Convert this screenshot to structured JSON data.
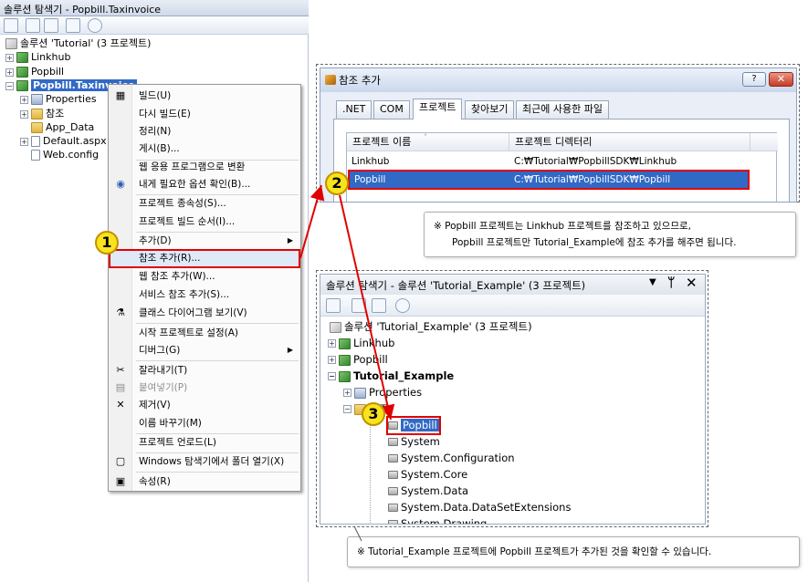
{
  "left_explorer": {
    "title": "솔루션 탐색기 - Popbill.Taxinvoice",
    "tree": {
      "solution": "솔루션 'Tutorial' (3 프로젝트)",
      "items": [
        "Linkhub",
        "Popbill",
        "Popbill.Taxinvoice"
      ],
      "children": [
        "Properties",
        "참조",
        "App_Data",
        "Default.aspx",
        "Web.config"
      ]
    }
  },
  "context_menu": {
    "items": [
      {
        "label": "빌드(U)",
        "icon": "build-icon"
      },
      {
        "label": "다시 빌드(E)",
        "icon": ""
      },
      {
        "label": "정리(N)",
        "icon": ""
      },
      {
        "label": "게시(B)...",
        "icon": ""
      },
      {
        "label": "웹 응용 프로그램으로 변환",
        "icon": ""
      },
      {
        "label": "내게 필요한 옵션 확인(B)...",
        "icon": "accessibility-icon"
      },
      {
        "label": "프로젝트 종속성(S)...",
        "icon": ""
      },
      {
        "label": "프로젝트 빌드 순서(I)...",
        "icon": ""
      },
      {
        "label": "추가(D)",
        "icon": "",
        "submenu": true
      },
      {
        "label": "참조 추가(R)...",
        "icon": "",
        "highlighted": true
      },
      {
        "label": "웹 참조 추가(W)...",
        "icon": ""
      },
      {
        "label": "서비스 참조 추가(S)...",
        "icon": ""
      },
      {
        "label": "클래스 다이어그램 보기(V)",
        "icon": "class-diagram-icon"
      },
      {
        "label": "시작 프로젝트로 설정(A)",
        "icon": ""
      },
      {
        "label": "디버그(G)",
        "icon": "",
        "submenu": true
      },
      {
        "label": "잘라내기(T)",
        "icon": "scissors-icon"
      },
      {
        "label": "붙여넣기(P)",
        "icon": "paste-icon",
        "disabled": true
      },
      {
        "label": "제거(V)",
        "icon": "delete-icon"
      },
      {
        "label": "이름 바꾸기(M)",
        "icon": ""
      },
      {
        "label": "프로젝트 언로드(L)",
        "icon": ""
      },
      {
        "label": "Windows 탐색기에서 폴더 열기(X)",
        "icon": "open-folder-icon"
      },
      {
        "label": "속성(R)",
        "icon": "properties-icon"
      }
    ]
  },
  "badges": {
    "one": "1",
    "two": "2",
    "three": "3"
  },
  "reference_dialog": {
    "title": "참조 추가",
    "help_label": "?",
    "close_label": "✕",
    "tabs": [
      ".NET",
      "COM",
      "프로젝트",
      "찾아보기",
      "최근에 사용한 파일"
    ],
    "active_tab": "프로젝트",
    "columns": [
      "프로젝트 이름",
      "프로젝트 디렉터리"
    ],
    "rows": [
      {
        "name": "Linkhub",
        "dir": "C:₩Tutorial₩PopbillSDK₩Linkhub"
      },
      {
        "name": "Popbill",
        "dir": "C:₩Tutorial₩PopbillSDK₩Popbill",
        "selected": true
      }
    ]
  },
  "note_top": {
    "line1": "※ Popbill 프로젝트는 Linkhub 프로젝트를 참조하고 있으므로,",
    "line2": "Popbill 프로젝트만 Tutorial_Example에 참조 추가를 해주면 됩니다."
  },
  "bottom_explorer": {
    "title": "솔루션 탐색기 - 솔루션 'Tutorial_Example' (3 프로젝트)",
    "pin_label": "ᛘ",
    "close_label": "✕",
    "solution": "솔루션 'Tutorial_Example' (3 프로젝트)",
    "projects": [
      "Linkhub",
      "Popbill",
      "Tutorial_Example"
    ],
    "properties": "Properties",
    "references_folder": "참조",
    "references": [
      "Popbill",
      "System",
      "System.Configuration",
      "System.Core",
      "System.Data",
      "System.Data.DataSetExtensions",
      "System.Drawing"
    ]
  },
  "note_bottom": "※ Tutorial_Example 프로젝트에 Popbill 프로젝트가 추가된 것을 확인할 수 있습니다.",
  "colors": {
    "highlight_red": "#e10000",
    "selection_blue": "#3169c6",
    "badge_yellow": "#f8e31d"
  }
}
